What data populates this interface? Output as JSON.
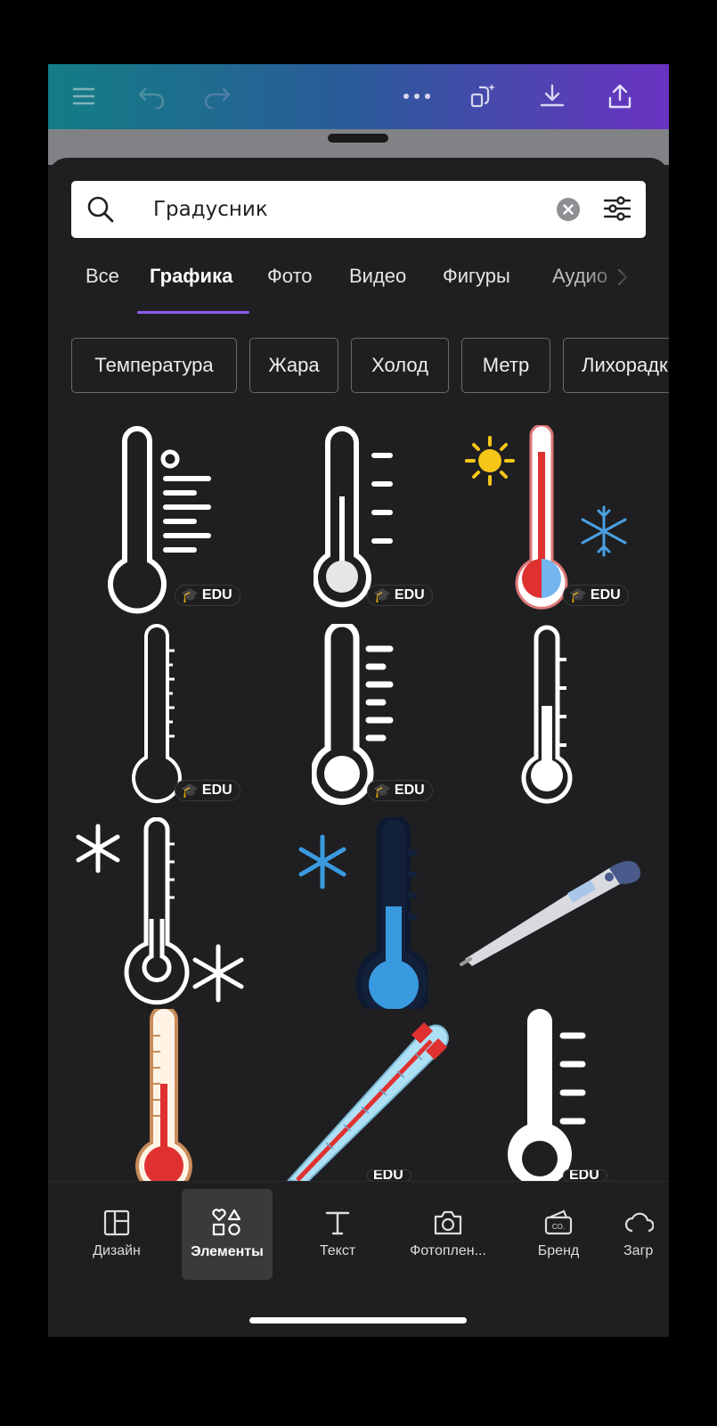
{
  "search": {
    "value": "Градусник"
  },
  "tabs": [
    {
      "label": "Все"
    },
    {
      "label": "Графика"
    },
    {
      "label": "Фото"
    },
    {
      "label": "Видео"
    },
    {
      "label": "Фигуры"
    },
    {
      "label": "Аудио"
    }
  ],
  "chips": [
    {
      "label": "Температура"
    },
    {
      "label": "Жара"
    },
    {
      "label": "Холод"
    },
    {
      "label": "Метр"
    },
    {
      "label": "Лихорадк"
    }
  ],
  "badge": {
    "edu": "EDU"
  },
  "bottom_nav": [
    {
      "label": "Дизайн"
    },
    {
      "label": "Элементы"
    },
    {
      "label": "Текст"
    },
    {
      "label": "Фотоплен..."
    },
    {
      "label": "Бренд"
    },
    {
      "label": "Загр"
    }
  ],
  "colors": {
    "topbar_gradient_start": "#137d85",
    "topbar_gradient_end": "#6a33c2",
    "active_tab_underline": "#8b5cf6",
    "panel_background": "#1f1f21"
  }
}
